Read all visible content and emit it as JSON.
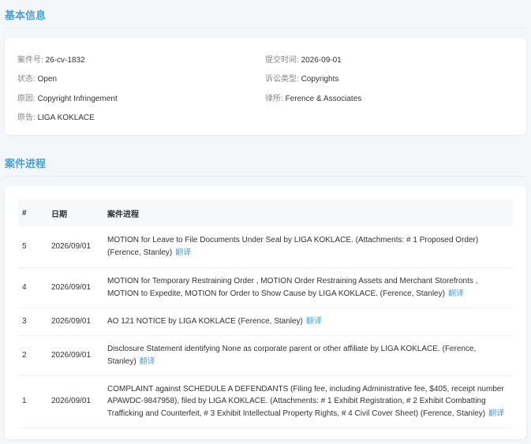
{
  "basic": {
    "title": "基本信息",
    "fields": {
      "case_no": {
        "label": "案件号:",
        "value": "26-cv-1832"
      },
      "submit_time": {
        "label": "提交时间:",
        "value": "2026-09-01"
      },
      "status": {
        "label": "状态:",
        "value": "Open"
      },
      "suit_type": {
        "label": "诉讼类型:",
        "value": "Copyrights"
      },
      "cause": {
        "label": "原因:",
        "value": "Copyright Infringement"
      },
      "law_firm": {
        "label": "律所:",
        "value": "Ference & Associates"
      },
      "plaintiff": {
        "label": "原告:",
        "value": "LIGA KOKLACE"
      }
    }
  },
  "progress": {
    "title": "案件进程",
    "columns": {
      "num": "#",
      "date": "日期",
      "text": "案件进程"
    },
    "translate_label": "翻译",
    "rows": [
      {
        "num": "5",
        "date": "2026/09/01",
        "text": "MOTION for Leave to File Documents Under Seal by LIGA KOKLACE. (Attachments: # 1 Proposed Order) (Ference, Stanley)"
      },
      {
        "num": "4",
        "date": "2026/09/01",
        "text": "MOTION for Temporary Restraining Order , MOTION Order Restraining Assets and Merchant Storefronts , MOTION to Expedite, MOTION for Order to Show Cause by LIGA KOKLACE. (Ference, Stanley)"
      },
      {
        "num": "3",
        "date": "2026/09/01",
        "text": "AO 121 NOTICE by LIGA KOKLACE (Ference, Stanley)"
      },
      {
        "num": "2",
        "date": "2026/09/01",
        "text": "Disclosure Statement identifying None as corporate parent or other affiliate by LIGA KOKLACE. (Ference, Stanley)"
      },
      {
        "num": "1",
        "date": "2026/09/01",
        "text": "COMPLAINT against SCHEDULE A DEFENDANTS (Filing fee, including Administrative fee, $405, receipt number APAWDC-9847958), filed by LIGA KOKLACE. (Attachments: # 1 Exhibit Registration, # 2 Exhibit Combatting Trafficking and Counterfeit, # 3 Exhibit Intellectual Property Rights, # 4 Civil Cover Sheet) (Ference, Stanley)"
      }
    ]
  },
  "colors": {
    "accent": "#4a9fd8",
    "background": "#f4f7fa"
  }
}
